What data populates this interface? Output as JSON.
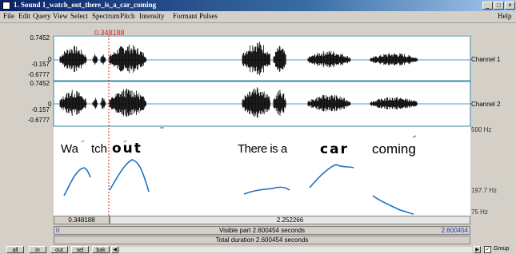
{
  "window": {
    "title": "1. Sound 1_watch_out_there_is_a_car_coming"
  },
  "window_controls": {
    "minimize": "_",
    "maximize": "□",
    "close": "×"
  },
  "menu": {
    "items": [
      "File",
      "Edit",
      "Query",
      "View",
      "Select",
      "Spectrum",
      "Pitch",
      "Intensity",
      "Formant",
      "Pulses"
    ],
    "help": "Help"
  },
  "cursor": {
    "time": "0.348188"
  },
  "channel1": {
    "max": "0.7452",
    "zero": "0",
    "min": "-0.6777",
    "mid": "-0.157",
    "label": "Channel 1"
  },
  "channel2": {
    "max": "0.7452",
    "zero": "0",
    "min": "-0.6777",
    "mid": "-0.157",
    "label": "Channel 2"
  },
  "pitch": {
    "top": "500 Hz",
    "mid": "197.7 Hz",
    "bottom": "75 Hz"
  },
  "transcript": {
    "w1": "Wa",
    "w2": "tch",
    "w3": "out",
    "w4": "There is a",
    "w5": "car",
    "w6": "coming"
  },
  "timebar": {
    "selection_left": "0.348188",
    "selection_right": "2.252266",
    "visible_start": "0",
    "visible_label": "Visible part 2.600454 seconds",
    "visible_end": "2.600454",
    "total_label": "Total duration 2.600454 seconds"
  },
  "bottom": {
    "all": "all",
    "in": "in",
    "out": "out",
    "sel": "sel",
    "bak": "bak",
    "group": "Group",
    "group_checked": true
  },
  "colors": {
    "waveform": "#000000",
    "pitch": "#1f6fc5",
    "cursor": "#e02020",
    "panel_border": "#3a8aa0",
    "selection": "#e8e8e8"
  }
}
